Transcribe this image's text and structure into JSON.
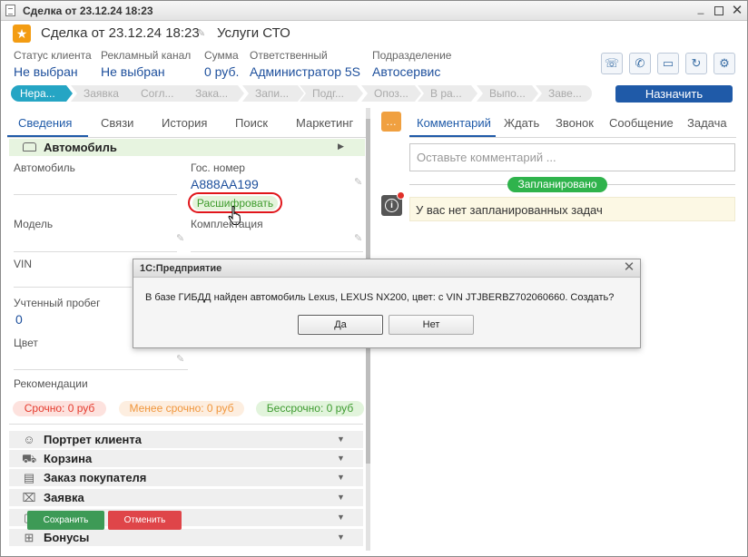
{
  "window": {
    "title": "Сделка от 23.12.24 18:23"
  },
  "header": {
    "deal_title": "Сделка от 23.12.24 18:23",
    "service": "Услуги СТО"
  },
  "fields": [
    {
      "label": "Статус клиента",
      "value": "Не выбран"
    },
    {
      "label": "Рекламный канал",
      "value": "Не выбран"
    },
    {
      "label": "Сумма",
      "value": "0 руб."
    },
    {
      "label": "Ответственный",
      "value": "Администратор 5S"
    },
    {
      "label": "Подразделение",
      "value": "Автосервис"
    }
  ],
  "toolbar_icons": [
    "call-transfer-icon",
    "phone-icon",
    "chat-icon",
    "refresh-icon",
    "gear-icon"
  ],
  "stages": [
    "Нера...",
    "Заявка",
    "Согл...",
    "Зака...",
    "Запи...",
    "Подг...",
    "Опоз...",
    "В ра...",
    "Выпо...",
    "Заве..."
  ],
  "assign_label": "Назначить",
  "left_tabs": [
    "Сведения",
    "Связи",
    "История",
    "Поиск",
    "Маркетинг"
  ],
  "car": {
    "section_title": "Автомобиль",
    "car_label": "Автомобиль",
    "plate_label": "Гос. номер",
    "plate_value": "А888АА199",
    "decode_label": "Расшифровать",
    "model_label": "Модель",
    "equipment_label": "Комплектация",
    "vin_label": "VIN",
    "mileage_label": "Учтенный пробег",
    "mileage_value": "0",
    "color_label": "Цвет",
    "recommendations_label": "Рекомендации"
  },
  "badges": {
    "urgent": "Срочно: 0 руб",
    "less_urgent": "Менее срочно: 0 руб",
    "not_urgent": "Бессрочно: 0 руб"
  },
  "sections": [
    {
      "icon": "person-icon",
      "title": "Портрет клиента"
    },
    {
      "icon": "cart-icon",
      "title": "Корзина"
    },
    {
      "icon": "document-icon",
      "title": "Заказ покупателя"
    },
    {
      "icon": "inbox-icon",
      "title": "Заявка"
    },
    {
      "icon": "clipboard-icon",
      "title": ""
    },
    {
      "icon": "gift-icon",
      "title": "Бонусы"
    }
  ],
  "bottom": {
    "save_label": "Сохранить",
    "cancel_label": "Отменить"
  },
  "right_tabs": [
    "Комментарий",
    "Ждать",
    "Звонок",
    "Сообщение",
    "Задача"
  ],
  "comment": {
    "placeholder": "Оставьте комментарий ..."
  },
  "planned_label": "Запланировано",
  "no_tasks_text": "У вас нет запланированных задач",
  "dialog": {
    "title": "1С:Предприятие",
    "message": "В базе ГИБДД найден автомобиль Lexus, LEXUS NX200, цвет:  с VIN JTJBERBZ702060660. Создать?",
    "yes_label": "Да",
    "no_label": "Нет"
  },
  "colors": {
    "accent": "#1f5aa8",
    "stage_active": "#25a5c4",
    "highlight": "#e0161b",
    "save": "#3d9a56",
    "cancel": "#df4549"
  }
}
